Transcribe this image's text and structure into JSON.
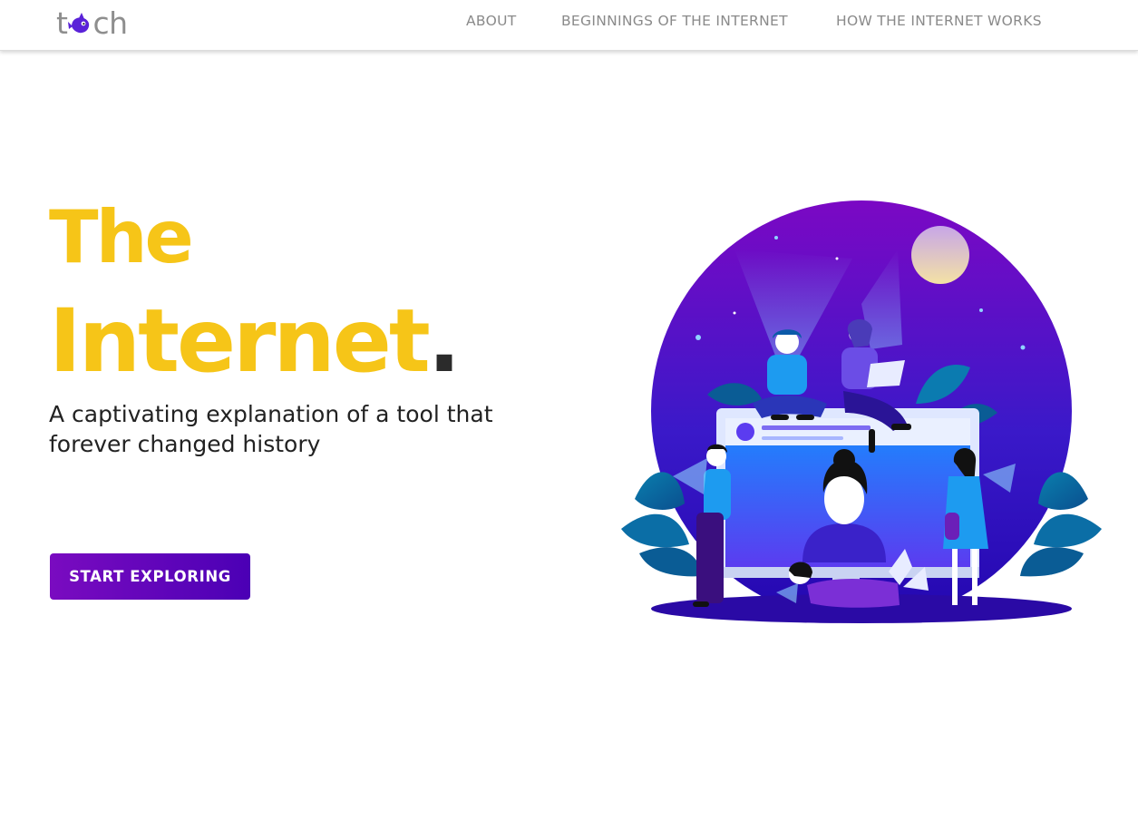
{
  "header": {
    "logo": {
      "before": "t",
      "after": "ch",
      "icon": "fish-icon"
    },
    "nav": [
      {
        "label": "ABOUT"
      },
      {
        "label": "BEGINNINGS OF THE INTERNET"
      },
      {
        "label": "HOW THE INTERNET WORKS"
      }
    ]
  },
  "hero": {
    "title_line1": "The",
    "title_line2": "Internet",
    "title_dot": ".",
    "subtitle": "A captivating explanation of a tool that forever changed history",
    "cta_label": "START EXPLORING"
  },
  "illustration": {
    "subject": "people-using-devices-illustration"
  },
  "colors": {
    "accent_yellow": "#f6c518",
    "button_purple": "#6a06bd",
    "nav_text": "#8a8a8a",
    "text_dark": "#222222"
  }
}
